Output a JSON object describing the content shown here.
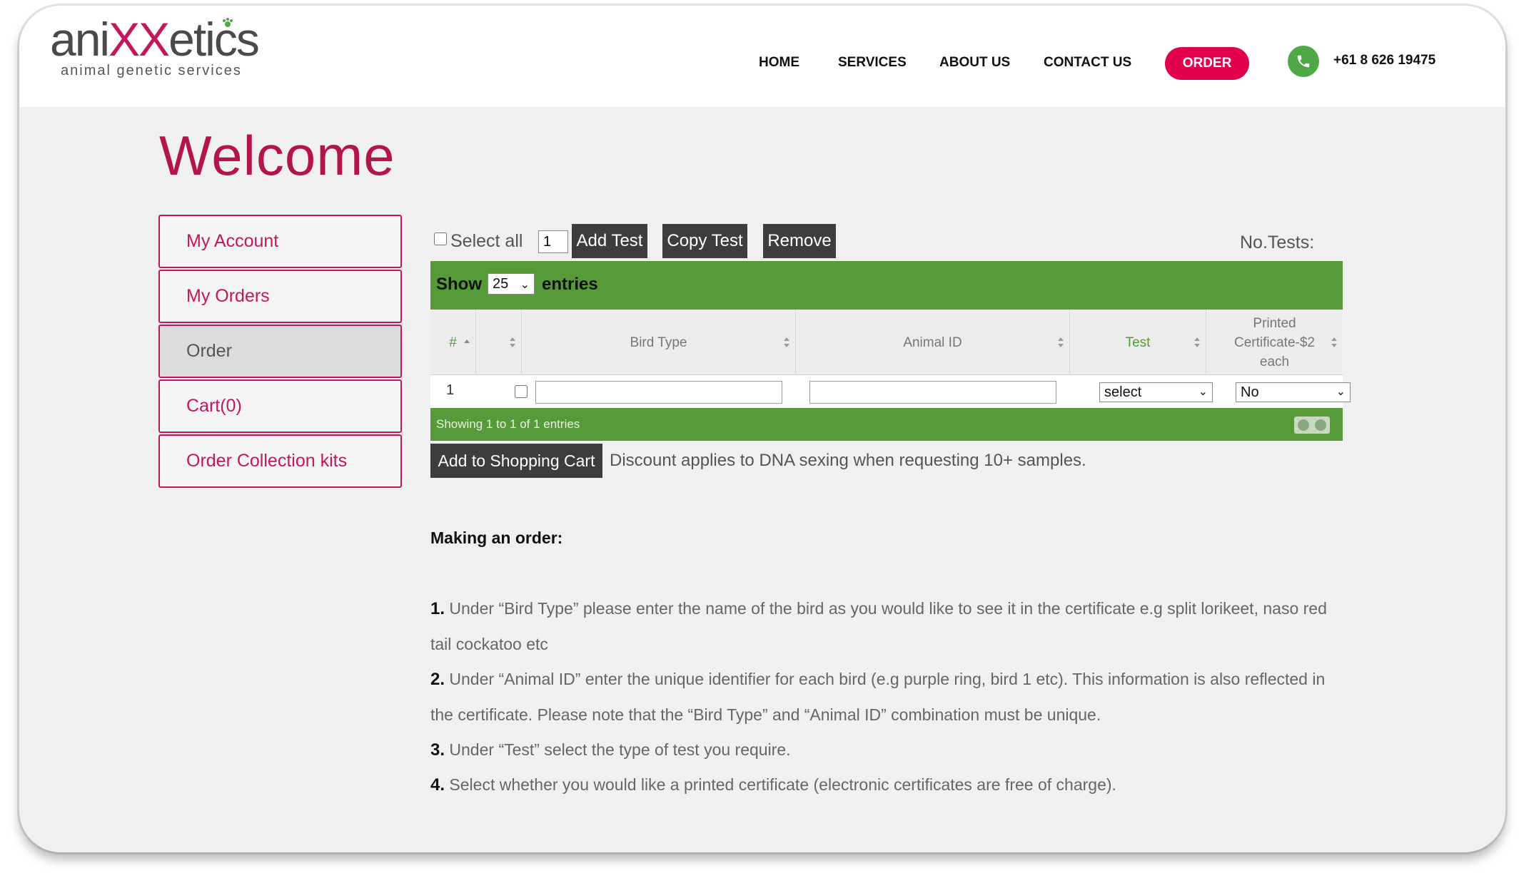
{
  "brand": {
    "logo_word_prefix": "ani",
    "logo_word_mid": "XX",
    "logo_word_suffix": "etics",
    "tagline": "animal genetic services"
  },
  "nav": {
    "items": [
      "HOME",
      "SERVICES",
      "ABOUT US",
      "CONTACT US"
    ],
    "order_label": "ORDER",
    "phone": "+61 8 626 19475"
  },
  "page": {
    "title": "Welcome"
  },
  "sidebar": {
    "items": [
      {
        "label": "My Account",
        "active": false
      },
      {
        "label": "My Orders",
        "active": false
      },
      {
        "label": "Order",
        "active": true
      },
      {
        "label": "Cart(0)",
        "active": false
      },
      {
        "label": "Order Collection kits",
        "active": false
      }
    ]
  },
  "toolbar": {
    "select_all_label": "Select all",
    "quantity_value": "1",
    "add_test_label": "Add Test",
    "copy_test_label": "Copy Test",
    "remove_label": "Remove",
    "no_tests_label": "No.Tests:"
  },
  "table": {
    "show_label": "Show",
    "page_size": "25",
    "entries_label": "entries",
    "columns": [
      "#",
      "",
      "Bird Type",
      "Animal ID",
      "Test",
      "Printed Certificate-$2 each"
    ],
    "rows": [
      {
        "num": "1",
        "bird_type": "",
        "animal_id": "",
        "test": "select",
        "printed": "No"
      }
    ],
    "showing_text": "Showing 1 to 1 of 1 entries"
  },
  "cart": {
    "add_label": "Add to Shopping Cart",
    "discount_text": "Discount applies to DNA sexing when requesting 10+ samples."
  },
  "instructions": {
    "heading": "Making an order:",
    "steps": [
      {
        "num": "1.",
        "text": "Under “Bird Type” please enter the name of the bird as you would like to see it in the certificate e.g split lorikeet, naso red tail cockatoo etc"
      },
      {
        "num": "2.",
        "text": "Under “Animal ID” enter the unique identifier for each bird (e.g purple ring, bird 1 etc). This information is also reflected in the certificate. Please note that the “Bird Type” and “Animal ID” combination must be unique."
      },
      {
        "num": "3.",
        "text": "Under “Test” select the type of test you require."
      },
      {
        "num": "4.",
        "text": "Select whether you would like a printed certificate (electronic certificates are free of charge)."
      }
    ]
  },
  "colors": {
    "brand_pink": "#c2185b",
    "order_red": "#e0004d",
    "table_green": "#569a3a",
    "phone_green": "#4fa845",
    "button_dark": "#3d3d3d"
  }
}
